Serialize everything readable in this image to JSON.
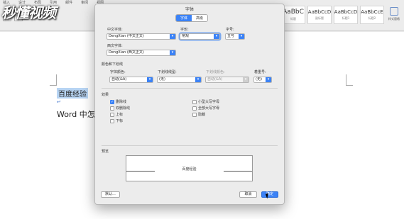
{
  "ribbon": {
    "tabs": [
      "插入",
      "设计",
      "布局",
      "引用",
      "邮件",
      "审阅",
      "视图"
    ],
    "styles": [
      {
        "big": "AaBbC",
        "name": "标题"
      },
      {
        "big": "AaBbCcD",
        "name": "副标题"
      },
      {
        "big": "AaBbCcD",
        "name": "标题1"
      },
      {
        "big": "AaBbCcE",
        "name": "标题2"
      }
    ],
    "pane_label": "样式窗格"
  },
  "watermark": "秒懂视频",
  "document": {
    "line1": "百度经验",
    "para_mark": "↵",
    "line2": "Word 中怎么"
  },
  "dialog": {
    "title": "字体",
    "tabs": [
      {
        "label": "字体",
        "active": true
      },
      {
        "label": "高级",
        "active": false
      }
    ],
    "chinese_font_label": "中文字体:",
    "chinese_font_value": "DengXian (中文正文)",
    "style_label": "字形:",
    "style_value": "常规",
    "size_label": "字号:",
    "size_value": "五号",
    "western_font_label": "西文字体:",
    "western_font_value": "DengXian (西文正文)",
    "color_section": "颜色和下划线",
    "font_color_label": "字体颜色:",
    "font_color_value": "自动(&A)",
    "underline_type_label": "下划线线型:",
    "underline_type_value": "(无)",
    "underline_color_label": "下划线颜色:",
    "underline_color_value": "自动(&A)",
    "emphasis_label": "着重号:",
    "emphasis_value": "(无)",
    "effects_section": "效果",
    "effects_left": [
      {
        "label": "删除线",
        "checked": true
      },
      {
        "label": "双删除线",
        "checked": false
      },
      {
        "label": "上标",
        "checked": false
      },
      {
        "label": "下标",
        "checked": false
      }
    ],
    "effects_right": [
      {
        "label": "小型大写字母",
        "checked": false
      },
      {
        "label": "全部大写字母",
        "checked": false
      },
      {
        "label": "隐藏",
        "checked": false
      }
    ],
    "preview_section": "预览",
    "preview_text": "百度经验",
    "default_button": "默认...",
    "cancel_button": "取消",
    "ok_button": "确定"
  },
  "colors": {
    "accent": "#3b82f6",
    "selection": "#b7d4f3"
  }
}
